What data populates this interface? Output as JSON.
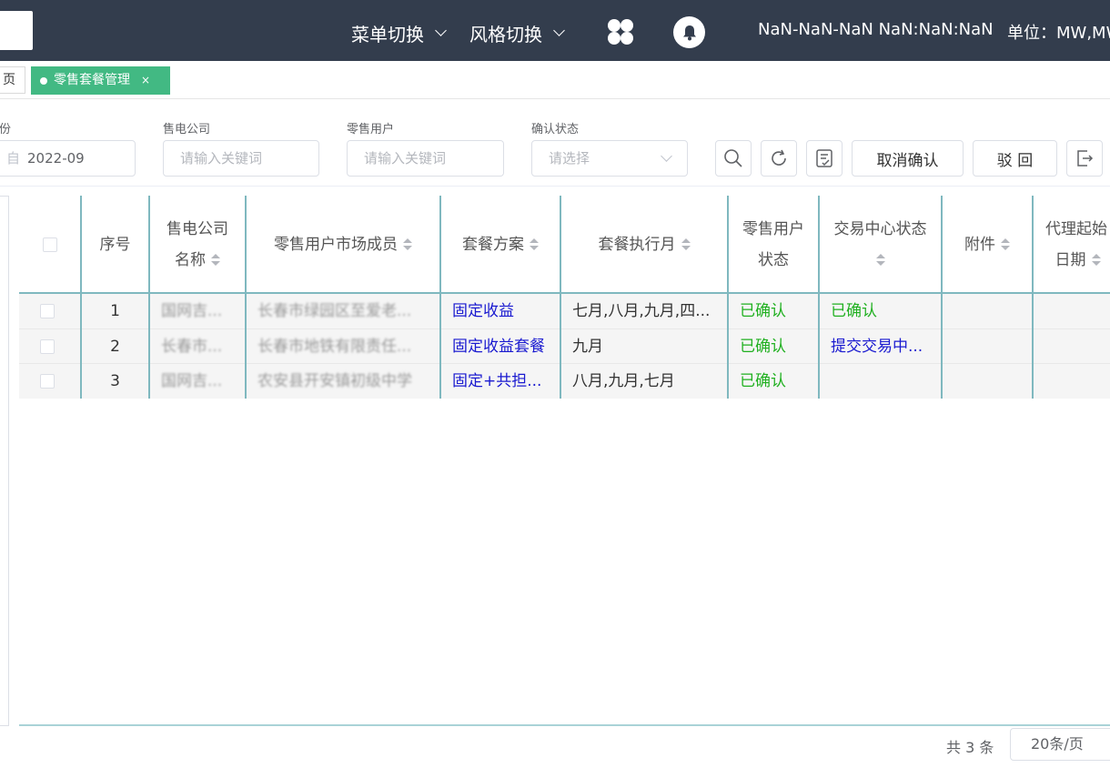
{
  "header": {
    "menu_switch": "菜单切换",
    "style_switch": "风格切换",
    "datetime": "NaN-NaN-NaN NaN:NaN:NaN",
    "unit": "单位：MW,MWh"
  },
  "tags": {
    "home": "页",
    "active": "零售套餐管理",
    "close": "×"
  },
  "filters": {
    "month": {
      "label": "份",
      "value": "2022-09",
      "prefix": "自"
    },
    "company": {
      "label": "售电公司",
      "placeholder": "请输入关键词"
    },
    "retail_user": {
      "label": "零售用户",
      "placeholder": "请输入关键词"
    },
    "confirm_status": {
      "label": "确认状态",
      "placeholder": "请选择"
    },
    "cancel_confirm": "取消确认",
    "reject": "驳 回"
  },
  "table": {
    "headers": {
      "index": "序号",
      "company_l1": "售电公司",
      "company_l2": "名称",
      "member": "零售用户市场成员",
      "plan": "套餐方案",
      "month": "套餐执行月",
      "user_status_l1": "零售用户",
      "user_status_l2": "状态",
      "center_status": "交易中心状态",
      "attachment": "附件",
      "agent_start_l1": "代理起始",
      "agent_start_l2": "日期"
    },
    "rows": [
      {
        "index": "1",
        "company": "国网吉...",
        "member": "长春市绿园区至爱老...",
        "plan": "固定收益",
        "month": "七月,八月,九月,四...",
        "user_status": "已确认",
        "center_status": "已确认"
      },
      {
        "index": "2",
        "company": "长春市...",
        "member": "长春市地铁有限责任...",
        "plan": "固定收益套餐",
        "month": "九月",
        "user_status": "已确认",
        "center_status": "提交交易中..."
      },
      {
        "index": "3",
        "company": "国网吉...",
        "member": "农安县开安镇初级中学",
        "plan": "固定+共担...",
        "month": "八月,九月,七月",
        "user_status": "已确认",
        "center_status": ""
      }
    ]
  },
  "pagination": {
    "total": "共 3 条",
    "page_size": "20条/页"
  },
  "colors": {
    "header_bg": "#333d4d",
    "tag_active": "#42b983",
    "confirmed_green": "#20b020",
    "plan_blue": "#1a1ad0"
  }
}
